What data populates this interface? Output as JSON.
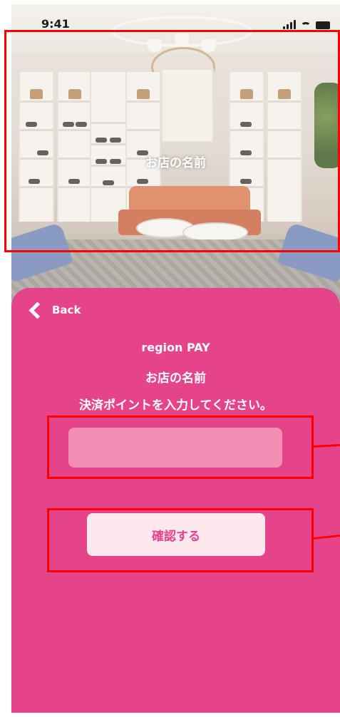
{
  "status_bar": {
    "time": "9:41"
  },
  "header": {
    "store_name": "お店の名前"
  },
  "panel": {
    "back_label": "Back",
    "brand": "region PAY",
    "store_name": "お店の名前",
    "instruction": "決済ポイントを入力してください。",
    "amount_value": "",
    "confirm_label": "確認する"
  },
  "colors": {
    "panel_bg": "#e5438a",
    "input_bg": "#f28eb4",
    "button_bg": "#fde8ee",
    "button_text": "#e5438a",
    "annotation": "#ff0000"
  },
  "icons": [
    "back-chevron-icon",
    "signal-icon",
    "wifi-icon",
    "battery-icon"
  ]
}
